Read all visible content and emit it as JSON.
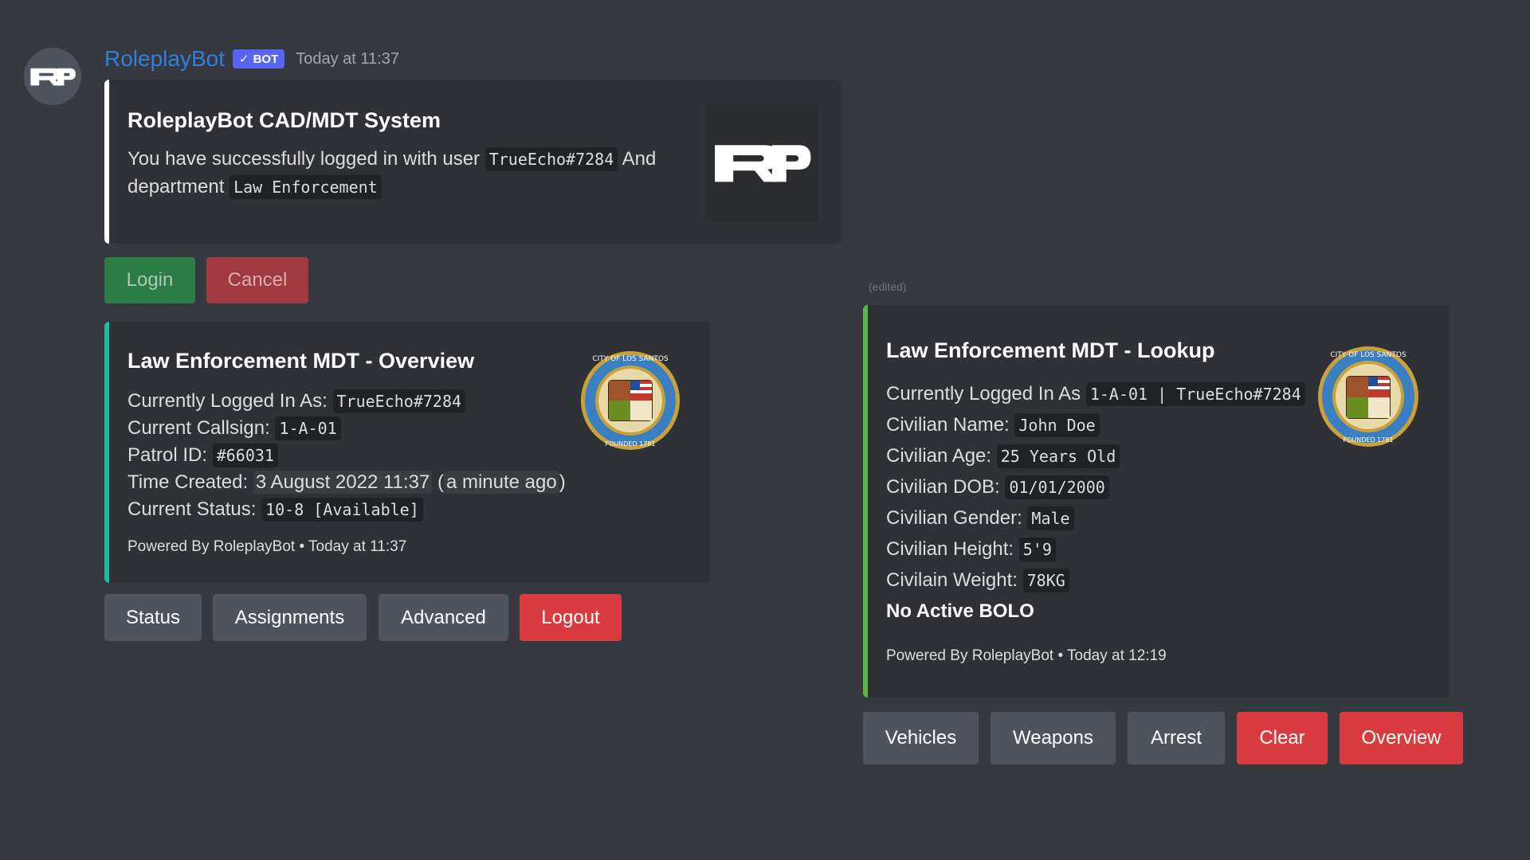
{
  "message": {
    "username": "RoleplayBot",
    "badge": "BOT",
    "timestamp": "Today at 11:37",
    "edited": "(edited)"
  },
  "login_embed": {
    "title": "RoleplayBot CAD/MDT System",
    "line1_prefix": "You have successfully logged in with user",
    "user": "TrueEcho#7284",
    "line1_suffix": "And",
    "line2_prefix": "department",
    "department": "Law Enforcement",
    "accent": "#ffffff"
  },
  "login_buttons": {
    "login": "Login",
    "cancel": "Cancel"
  },
  "overview_embed": {
    "title": "Law Enforcement MDT - Overview",
    "rows": [
      {
        "label": "Currently Logged In As:",
        "value": "TrueEcho#7284"
      },
      {
        "label": "Current Callsign:",
        "value": "1-A-01"
      },
      {
        "label": "Patrol ID:",
        "value": "#66031"
      },
      {
        "label": "Current Status:",
        "value": "10-8 [Available]"
      }
    ],
    "time_label": "Time Created:",
    "time_value": "3 August 2022 11:37",
    "time_relative": "a minute ago",
    "footer_brand": "Powered By RoleplayBot",
    "footer_time": "Today at 11:37",
    "accent": "#1abc9c"
  },
  "overview_buttons": {
    "status": "Status",
    "assignments": "Assignments",
    "advanced": "Advanced",
    "logout": "Logout"
  },
  "lookup_embed": {
    "title": "Law Enforcement MDT - Lookup",
    "rows": [
      {
        "label": "Currently Logged In As",
        "value": "1-A-01 | TrueEcho#7284"
      },
      {
        "label": "Civilian Name:",
        "value": "John Doe"
      },
      {
        "label": "Civilian Age:",
        "value": "25 Years Old"
      },
      {
        "label": "Civilian DOB:",
        "value": "01/01/2000"
      },
      {
        "label": "Civilian Gender:",
        "value": "Male"
      },
      {
        "label": "Civilian Height:",
        "value": "5'9"
      },
      {
        "label": "Civilain Weight:",
        "value": "78KG"
      }
    ],
    "bolo": "No Active BOLO",
    "footer_brand": "Powered By RoleplayBot",
    "footer_time": "Today at 12:19",
    "accent": "#57b846"
  },
  "lookup_buttons": {
    "vehicles": "Vehicles",
    "weapons": "Weapons",
    "arrest": "Arrest",
    "clear": "Clear",
    "overview": "Overview"
  },
  "seal": {
    "top_text": "CITY OF LOS SANTOS",
    "bottom_text": "FOUNDED 1781"
  },
  "icons": {
    "avatar": "rp-logo-icon",
    "thumbnail": "rp-logo-icon",
    "seal": "city-seal-icon"
  }
}
